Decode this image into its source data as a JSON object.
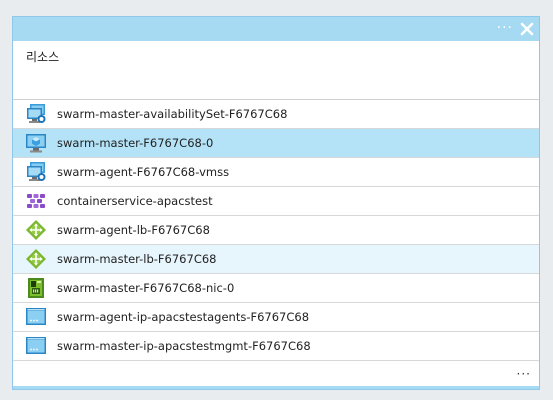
{
  "blade": {
    "more_label": "···",
    "heading": "리소스",
    "footer_more": "···"
  },
  "resources": [
    {
      "name": "swarm-master-availabilitySet-F6767C68",
      "icon": "availability-set-icon"
    },
    {
      "name": "swarm-master-F6767C68-0",
      "icon": "virtual-machine-icon"
    },
    {
      "name": "swarm-agent-F6767C68-vmss",
      "icon": "vm-scale-set-icon"
    },
    {
      "name": "containerservice-apacstest",
      "icon": "container-service-icon"
    },
    {
      "name": "swarm-agent-lb-F6767C68",
      "icon": "load-balancer-icon"
    },
    {
      "name": "swarm-master-lb-F6767C68",
      "icon": "load-balancer-icon"
    },
    {
      "name": "swarm-master-F6767C68-nic-0",
      "icon": "network-interface-icon"
    },
    {
      "name": "swarm-agent-ip-apacstestagents-F6767C68",
      "icon": "public-ip-icon"
    },
    {
      "name": "swarm-master-ip-apacstestmgmt-F6767C68",
      "icon": "public-ip-icon"
    }
  ],
  "colors": {
    "titlebar": "#a6daf2",
    "selected_row": "#b4e3f7",
    "hover_row": "#e7f5fc"
  }
}
